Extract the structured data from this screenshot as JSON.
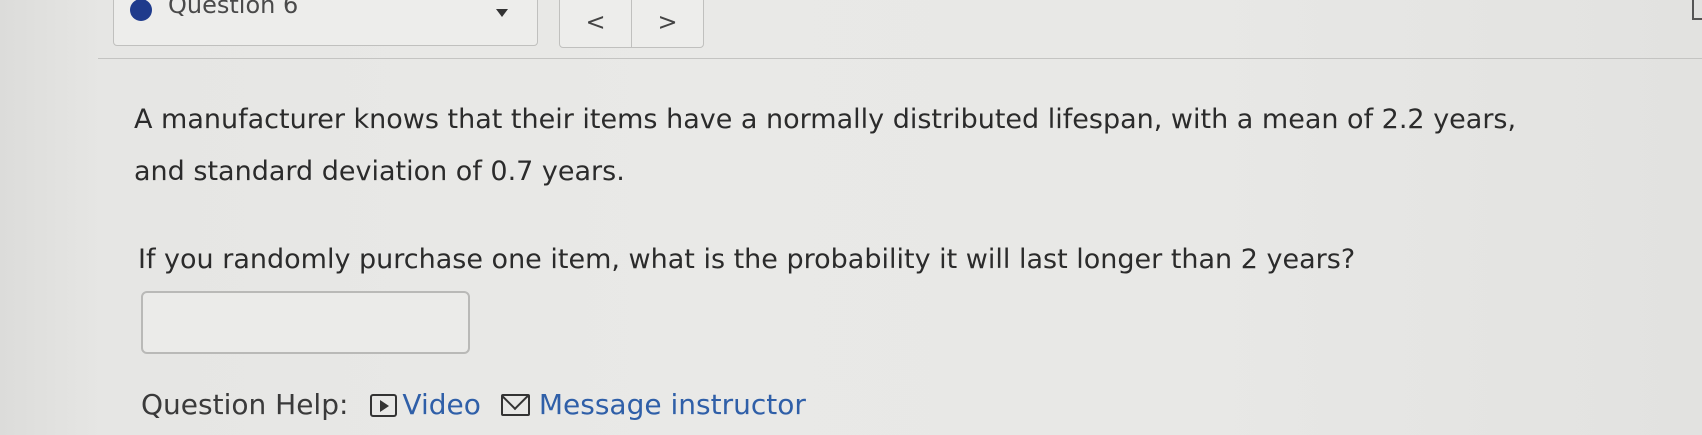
{
  "header": {
    "question_label": "Question 6",
    "prev_label": "<",
    "next_label": ">"
  },
  "question": {
    "text": "A manufacturer knows that their items have a normally distributed lifespan, with a mean of 2.2 years, and standard deviation of 0.7 years.",
    "prompt": "If you randomly purchase one item, what is the probability it will last longer than 2 years?",
    "answer_value": ""
  },
  "help": {
    "label": "Question Help:",
    "video_label": "Video",
    "message_label": "Message instructor",
    "video_icon": "play-icon",
    "message_icon": "envelope-icon"
  },
  "colors": {
    "status_dot": "#1f3b8c",
    "link": "#2f5fa8"
  }
}
